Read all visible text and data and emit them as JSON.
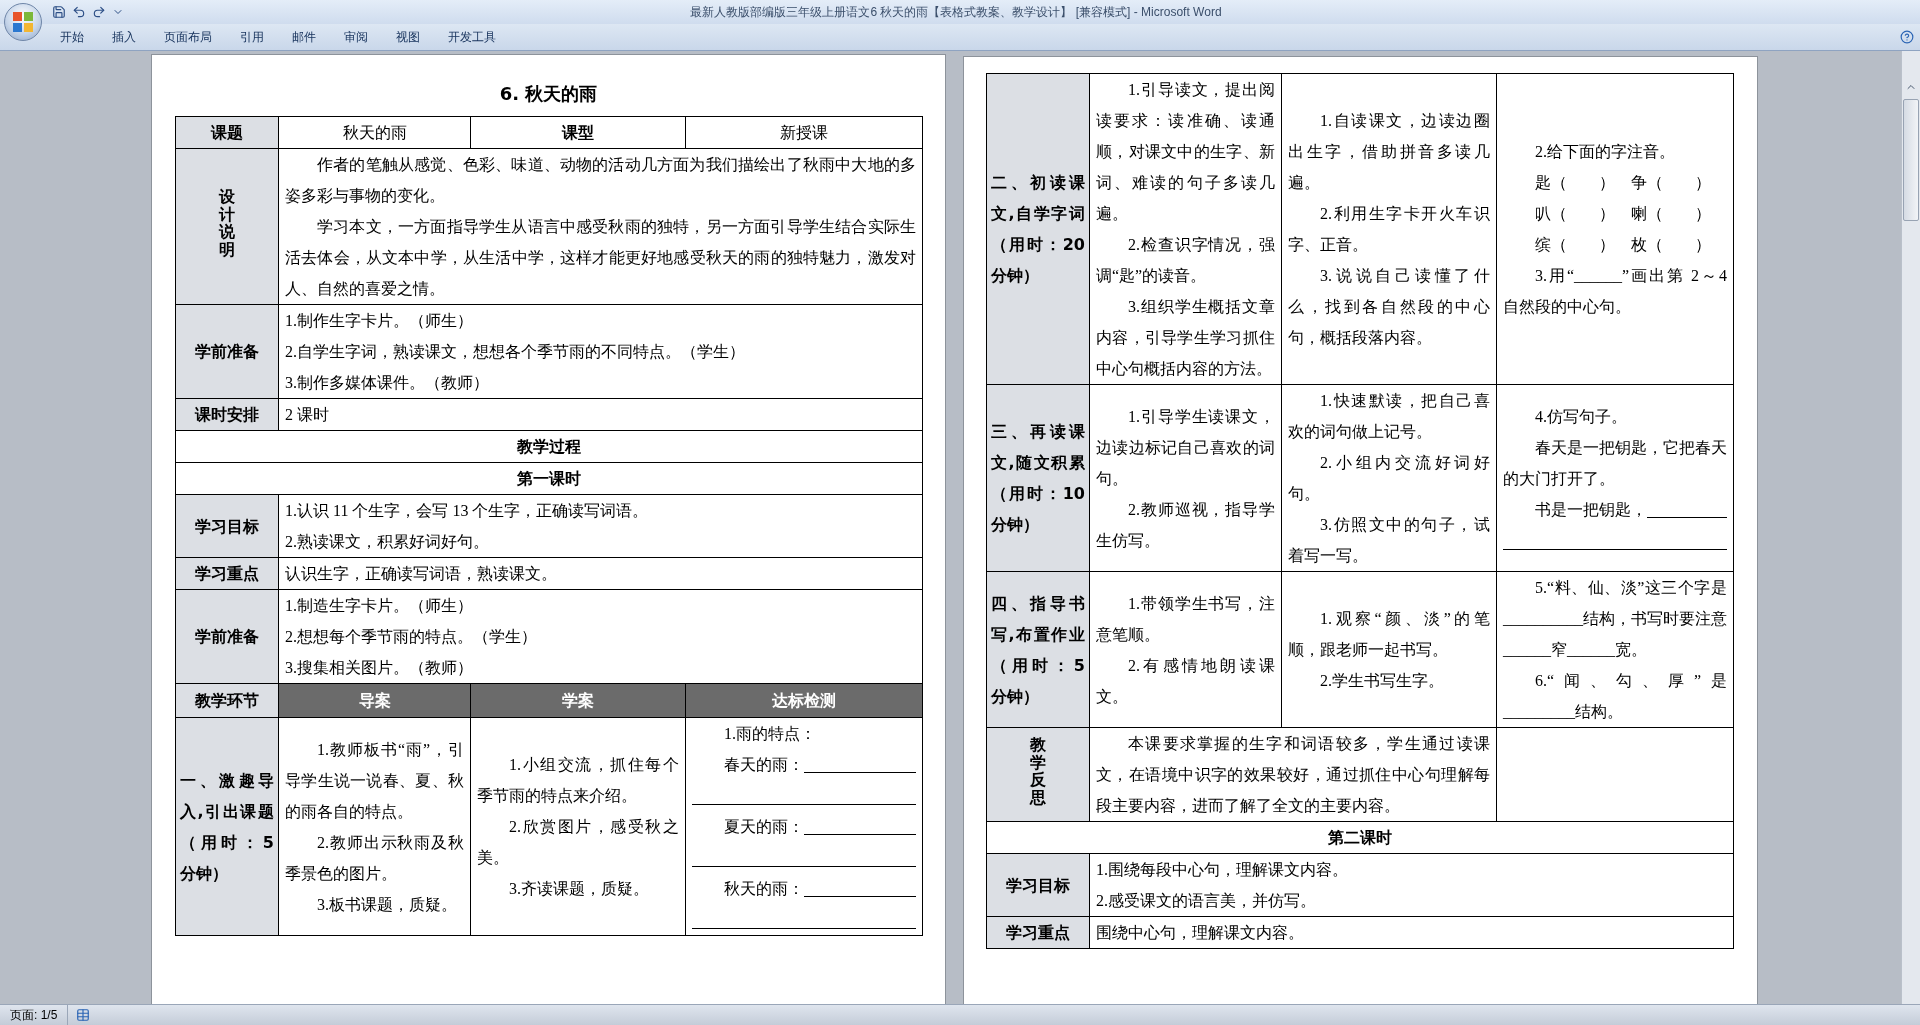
{
  "window": {
    "title": "最新人教版部编版三年级上册语文6 秋天的雨【表格式教案、教学设计】 [兼容模式] - Microsoft Word"
  },
  "ribbon_tabs": [
    "开始",
    "插入",
    "页面布局",
    "引用",
    "邮件",
    "审阅",
    "视图",
    "开发工具"
  ],
  "pages": [
    {
      "heading": "6. 秋天的雨",
      "rows": [
        {
          "kind": "title_row",
          "cells": [
            {
              "kind": "label",
              "text": "课题"
            },
            {
              "kind": "value",
              "text": "秋天的雨"
            },
            {
              "kind": "heading",
              "text": "课型"
            },
            {
              "kind": "value",
              "text": "新授课"
            }
          ]
        },
        {
          "kind": "field",
          "label": "设计说明",
          "vertical": true,
          "indent": true,
          "paragraphs": [
            "作者的笔触从感觉、色彩、味道、动物的活动几方面为我们描绘出了秋雨中大地的多姿多彩与事物的变化。",
            "学习本文，一方面指导学生从语言中感受秋雨的独特，另一方面引导学生结合实际生活去体会，从文本中学，从生活中学，这样才能更好地感受秋天的雨的独特魅力，激发对人、自然的喜爱之情。"
          ]
        },
        {
          "kind": "field",
          "label": "学前准备",
          "vertical": false,
          "indent": false,
          "paragraphs": [
            "1.制作生字卡片。（师生）",
            "2.自学生字词，熟读课文，想想各个季节雨的不同特点。（学生）",
            "3.制作多媒体课件。（教师）"
          ]
        },
        {
          "kind": "field",
          "label": "课时安排",
          "vertical": false,
          "indent": false,
          "paragraphs": [
            "2 课时"
          ]
        },
        {
          "kind": "section",
          "text": "教学过程"
        },
        {
          "kind": "section",
          "text": "第一课时"
        },
        {
          "kind": "field",
          "label": "学习目标",
          "vertical": false,
          "indent": false,
          "paragraphs": [
            "1.认识 11 个生字，会写 13 个生字，正确读写词语。",
            "2.熟读课文，积累好词好句。"
          ]
        },
        {
          "kind": "field",
          "label": "学习重点",
          "vertical": false,
          "indent": false,
          "paragraphs": [
            "认识生字，正确读写词语，熟读课文。"
          ]
        },
        {
          "kind": "field",
          "label": "学前准备",
          "vertical": false,
          "indent": false,
          "paragraphs": [
            "1.制造生字卡片。（师生）",
            "2.想想每个季节雨的特点。（学生）",
            "3.搜集相关图片。（教师）"
          ]
        },
        {
          "kind": "columns_header",
          "label": "教学环节",
          "headings": [
            "导案",
            "学案",
            "达标检测"
          ]
        },
        {
          "kind": "step",
          "label": "一、激趣导入,引出课题（用时：5 分钟）",
          "cells": [
            {
              "indent": true,
              "paragraphs": [
                "1.教师板书“雨”，引导学生说一说春、夏、秋的雨各自的特点。",
                "2.教师出示秋雨及秋季景色的图片。",
                "3.板书课题，质疑。"
              ]
            },
            {
              "indent": true,
              "paragraphs": [
                "1.小组交流，抓住每个季节雨的特点来介绍。",
                "2.欣赏图片，感受秋之美。",
                "3.齐读课题，质疑。"
              ]
            },
            {
              "indent": true,
              "paragraphs": [
                "1.雨的特点：",
                {
                  "kind": "answer",
                  "text": "春天的雨："
                },
                {
                  "kind": "blank"
                },
                {
                  "kind": "answer",
                  "text": "夏天的雨："
                },
                {
                  "kind": "blank"
                },
                {
                  "kind": "answer",
                  "text": "秋天的雨："
                },
                {
                  "kind": "blank"
                }
              ]
            }
          ]
        }
      ]
    },
    {
      "rows": [
        {
          "kind": "step",
          "label": "二、初读课文,自学字词（用时：20 分钟）",
          "cells": [
            {
              "indent": true,
              "paragraphs": [
                "1.引导读文，提出阅读要求：读准确、读通顺，对课文中的生字、新词、难读的句子多读几遍。",
                "2.检查识字情况，强调“匙”的读音。",
                "3.组织学生概括文章内容，引导学生学习抓住中心句概括内容的方法。"
              ]
            },
            {
              "indent": true,
              "paragraphs": [
                "1.自读课文，边读边圈出生字，借助拼音多读几遍。",
                "2.利用生字卡开火车识字、正音。",
                "3.说说自己读懂了什么，找到各自然段的中心句，概括段落内容。"
              ]
            },
            {
              "indent": true,
              "paragraphs": [
                "2.给下面的字注音。",
                "匙（　　）　争（　　）",
                "叭（　　）　喇（　　）",
                "缤（　　）　枚（　　）",
                "3.用“______”画出第 2～4 自然段的中心句。"
              ]
            }
          ]
        },
        {
          "kind": "step",
          "label": "三、再读课文,随文积累（用时：10 分钟）",
          "cells": [
            {
              "indent": true,
              "paragraphs": [
                "1.引导学生读课文，边读边标记自己喜欢的词句。",
                "2.教师巡视，指导学生仿写。"
              ]
            },
            {
              "indent": true,
              "paragraphs": [
                "1.快速默读，把自己喜欢的词句做上记号。",
                "2.小组内交流好词好句。",
                "3.仿照文中的句子，试着写一写。"
              ]
            },
            {
              "indent": true,
              "paragraphs": [
                "4.仿写句子。",
                "春天是一把钥匙，它把春天的大门打开了。",
                {
                  "kind": "answer",
                  "text": "书是一把钥匙，"
                },
                {
                  "kind": "blank"
                }
              ]
            }
          ]
        },
        {
          "kind": "step",
          "label": "四、指导书写,布置作业（用时：5 分钟）",
          "cells": [
            {
              "indent": true,
              "paragraphs": [
                "1.带领学生书写，注意笔顺。",
                "2.有感情地朗读课文。"
              ]
            },
            {
              "indent": true,
              "paragraphs": [
                "1.观察“颜、淡”的笔顺，跟老师一起书写。",
                "2.学生书写生字。"
              ]
            },
            {
              "indent": true,
              "paragraphs": [
                "5.“料、仙、淡”这三个字是__________结构，书写时要注意______窄______宽。",
                "6.“闻、勾、厚”是_________结构。"
              ]
            }
          ]
        },
        {
          "kind": "reflection",
          "label": "教学反思",
          "indent": true,
          "paragraphs": [
            "本课要求掌握的生字和词语较多，学生通过读课文，在语境中识字的效果较好，通过抓住中心句理解每段主要内容，进而了解了全文的主要内容。"
          ]
        },
        {
          "kind": "section",
          "text": "第二课时"
        },
        {
          "kind": "field",
          "label": "学习目标",
          "vertical": false,
          "indent": false,
          "paragraphs": [
            "1.围绕每段中心句，理解课文内容。",
            "2.感受课文的语言美，并仿写。"
          ]
        },
        {
          "kind": "field",
          "label": "学习重点",
          "vertical": false,
          "indent": false,
          "paragraphs": [
            "围绕中心句，理解课文内容。"
          ]
        }
      ]
    }
  ],
  "status_bar": {
    "page": "页面: 1/5"
  }
}
